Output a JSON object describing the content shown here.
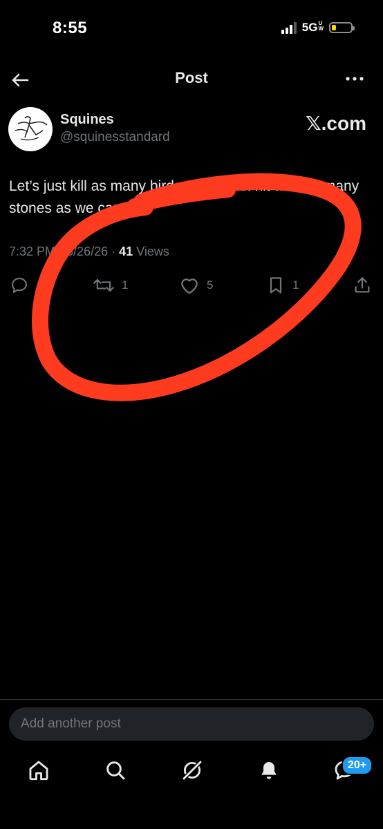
{
  "status_bar": {
    "time": "8:55",
    "network": "5G",
    "network_sup": "U",
    "network_sub": "W",
    "battery_color": "#ffd60a"
  },
  "header": {
    "title": "Post",
    "back_icon": "arrow-left-icon",
    "more_icon": "ellipsis-icon"
  },
  "author": {
    "name": "Squines",
    "handle": "@squinesstandard",
    "brand": "𝕏.com"
  },
  "post": {
    "text": "Let’s just kill as many birds as we can hit with as many stones as we can",
    "time": "7:32 PM",
    "date": "5/26/26",
    "separator": " · ",
    "views_count": "41",
    "views_label": " Views"
  },
  "actions": {
    "reply_count": "",
    "repost_count": "1",
    "like_count": "5",
    "bookmark_count": "1"
  },
  "composer": {
    "placeholder": "Add another post"
  },
  "tab_bar": {
    "items": [
      "home-icon",
      "search-icon",
      "grok-icon",
      "notifications-icon",
      "messages-icon"
    ],
    "messages_badge": "20+"
  },
  "colors": {
    "background": "#000000",
    "text_primary": "#e7e9ea",
    "text_secondary": "#71767b",
    "accent": "#1d9bf0",
    "annotation": "#ff3b1f"
  }
}
